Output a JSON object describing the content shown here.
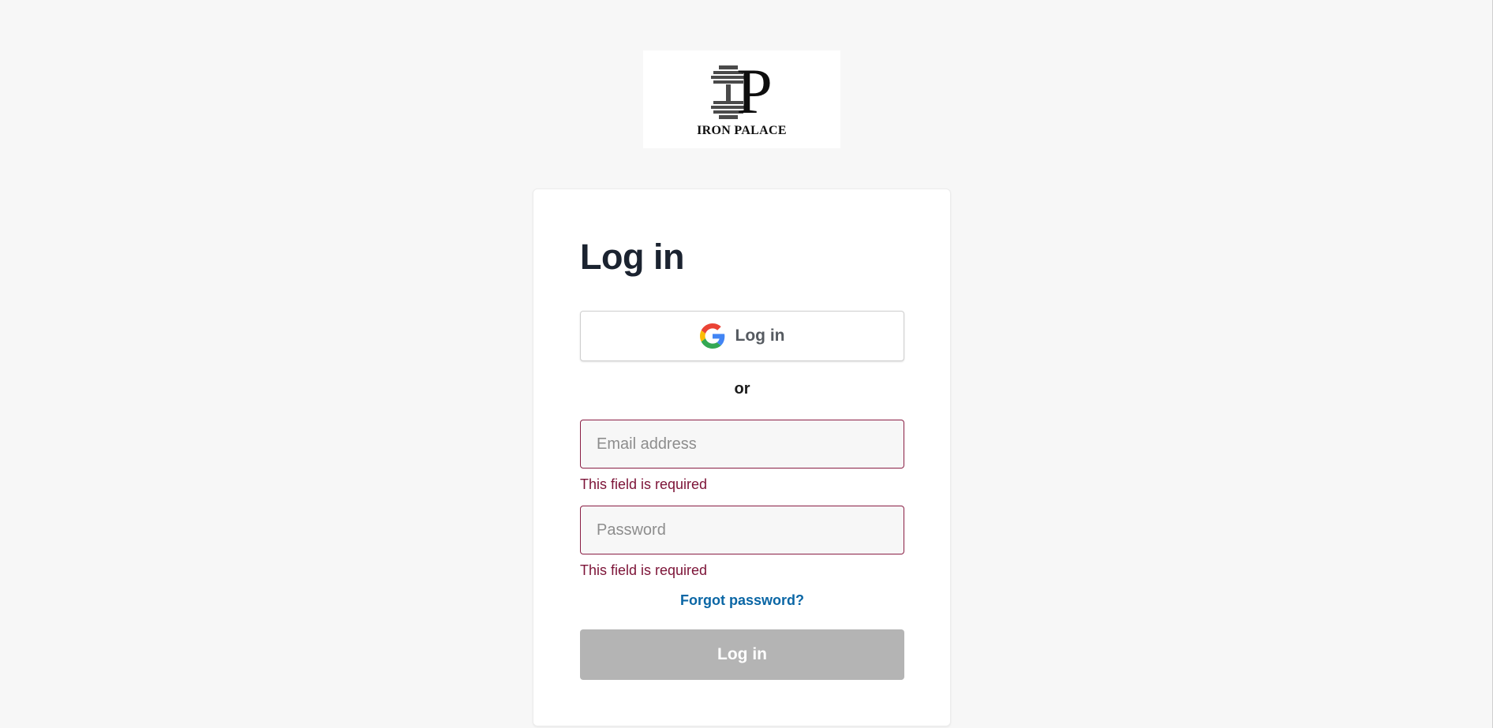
{
  "logo": {
    "letter": "P",
    "name": "IRON PALACE",
    "icon": "barbell-icon"
  },
  "login": {
    "title": "Log in",
    "google_button_label": "Log in",
    "google_icon": "google-icon",
    "separator": "or",
    "email_placeholder": "Email address",
    "password_placeholder": "Password",
    "email_error": "This field is required",
    "password_error": "This field is required",
    "forgot_password": "Forgot password?",
    "submit_label": "Log in"
  },
  "colors": {
    "background": "#f7f7f7",
    "error": "#7c1337",
    "link": "#0a66a5",
    "disabled_button": "#b4b4b4",
    "title": "#1b2330"
  }
}
